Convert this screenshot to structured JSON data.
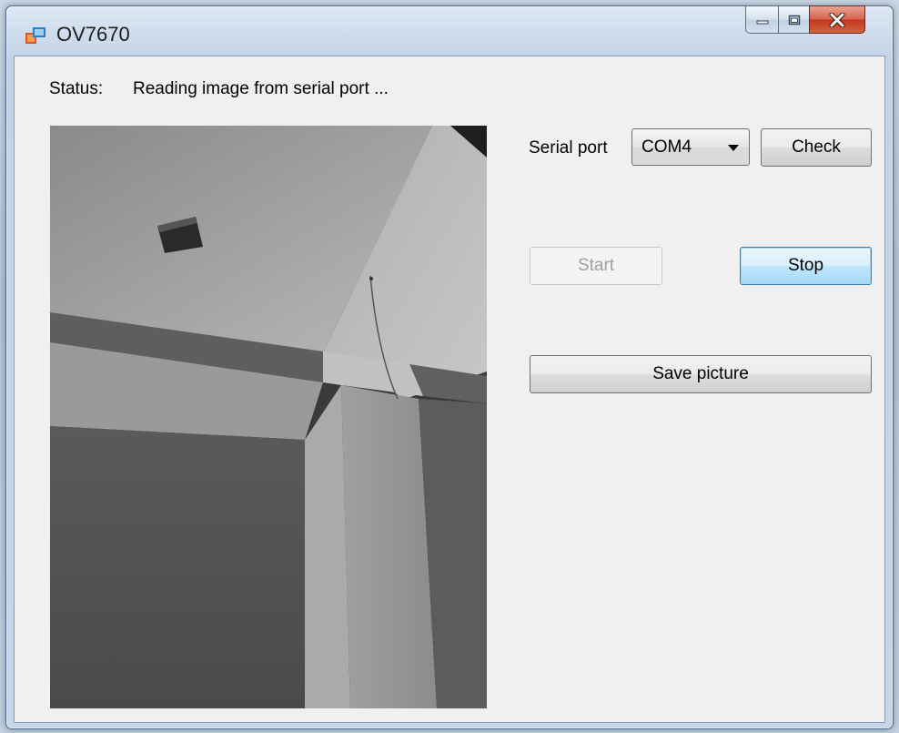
{
  "window": {
    "title": "OV7670",
    "min_label": "minimize",
    "max_label": "maximize",
    "close_label": "close"
  },
  "status": {
    "label": "Status:",
    "value": "Reading image from serial port ..."
  },
  "serial": {
    "label": "Serial port",
    "selected_port": "COM4",
    "check_label": "Check"
  },
  "controls": {
    "start_label": "Start",
    "stop_label": "Stop",
    "save_label": "Save picture",
    "start_enabled": false,
    "stop_focused": true
  },
  "preview": {
    "icon": "camera-frame-image",
    "grayscale": true
  }
}
